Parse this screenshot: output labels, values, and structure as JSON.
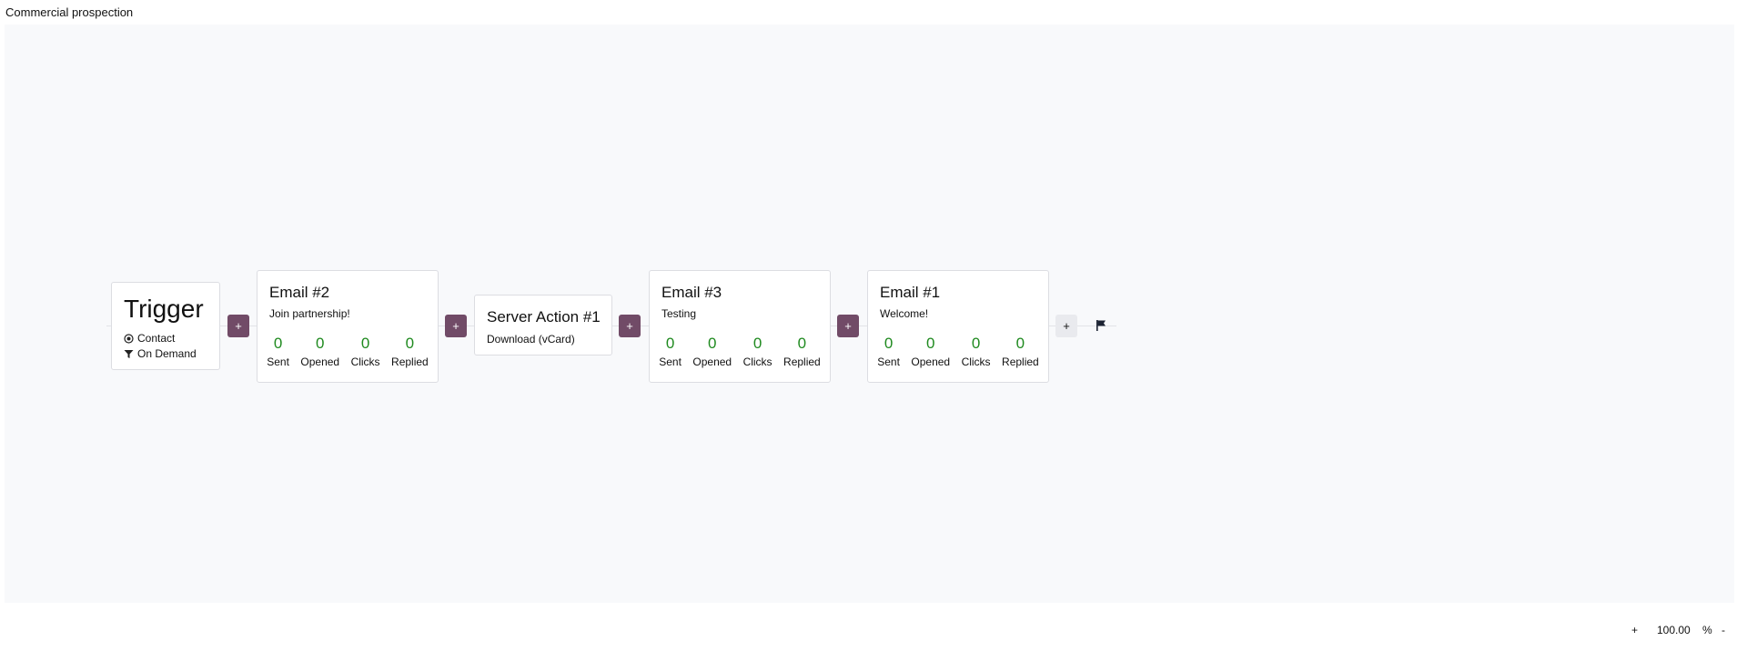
{
  "app_title": "Commercial prospection",
  "trigger": {
    "title": "Trigger",
    "model": "Contact",
    "mode": "On Demand"
  },
  "nodes": [
    {
      "title": "Email #2",
      "subtitle": "Join partnership!",
      "stats": [
        {
          "value": "0",
          "label": "Sent"
        },
        {
          "value": "0",
          "label": "Opened"
        },
        {
          "value": "0",
          "label": "Clicks"
        },
        {
          "value": "0",
          "label": "Replied"
        }
      ]
    },
    {
      "title": "Server Action #1",
      "subtitle": "Download (vCard)"
    },
    {
      "title": "Email #3",
      "subtitle": "Testing",
      "stats": [
        {
          "value": "0",
          "label": "Sent"
        },
        {
          "value": "0",
          "label": "Opened"
        },
        {
          "value": "0",
          "label": "Clicks"
        },
        {
          "value": "0",
          "label": "Replied"
        }
      ]
    },
    {
      "title": "Email #1",
      "subtitle": "Welcome!",
      "stats": [
        {
          "value": "0",
          "label": "Sent"
        },
        {
          "value": "0",
          "label": "Opened"
        },
        {
          "value": "0",
          "label": "Clicks"
        },
        {
          "value": "0",
          "label": "Replied"
        }
      ]
    }
  ],
  "add_label": "+",
  "zoom": {
    "in_label": "+",
    "value": "100.00",
    "unit": "%",
    "out_label": "-"
  },
  "colors": {
    "accent": "#714b67",
    "stat_value": "#1f8a1f",
    "canvas": "#f8f9fb"
  }
}
